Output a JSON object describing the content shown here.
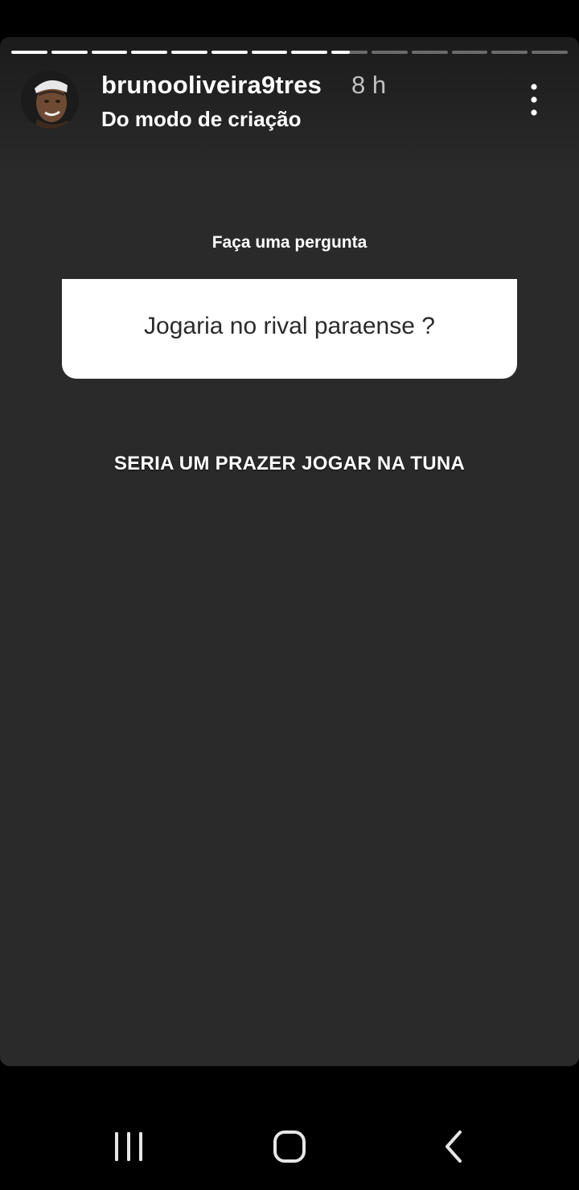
{
  "story": {
    "username": "brunooliveira9tres",
    "timestamp": "8 h",
    "subtitle": "Do modo de criação",
    "progress": {
      "total_segments": 14,
      "completed_segments": 8,
      "current_segment_fill": 0.5
    }
  },
  "question_sticker": {
    "label": "Faça uma pergunta",
    "question": "Jogaria no rival paraense ?"
  },
  "answer": {
    "text": "SERIA UM PRAZER JOGAR NA TUNA"
  },
  "icons": {
    "more": "more-vertical-icon",
    "recents": "recent-apps-icon",
    "home": "home-icon",
    "back": "back-icon"
  },
  "colors": {
    "story_background": "#2a2a2a",
    "sticker_background": "#ffffff",
    "question_text": "#2b2b2b",
    "text_primary": "#ffffff",
    "progress_inactive": "rgba(255,255,255,0.35)",
    "progress_active": "#ffffff",
    "nav_bar": "#000000"
  }
}
